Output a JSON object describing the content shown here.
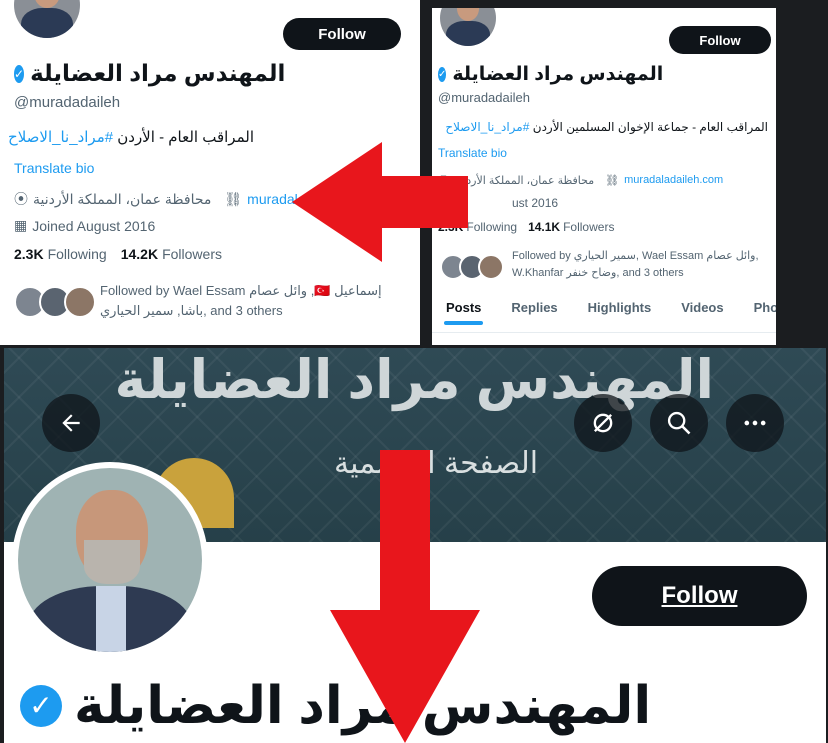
{
  "panel_left": {
    "follow_label": "Follow",
    "display_name": "المهندس مراد العضايلة",
    "handle": "@muradadaileh",
    "bio_text": "المراقب العام - الأردن ",
    "bio_hashtag": "#مراد_نا_الاصلاح",
    "translate": "Translate bio",
    "location": "محافظة عمان، المملكة الأردنية",
    "website": "muradaladail",
    "joined": "Joined August 2016",
    "following_count": "2.3K",
    "following_label": "Following",
    "followers_count": "14.2K",
    "followers_label": "Followers",
    "followed_by_line1": "Followed by Wael Essam وائل عصام ,🇹🇷 إسماعيل",
    "followed_by_line2": "باشا, سمير الحياري, and 3 others"
  },
  "panel_right": {
    "follow_label": "Follow",
    "display_name": "المهندس مراد العضايلة",
    "handle": "@muradadaileh",
    "bio_text": "المراقب العام - جماعة الإخوان المسلمين الأردن ",
    "bio_hashtag": "#مراد_نا_الاصلاح",
    "translate": "Translate bio",
    "location": "محافظة عمان، المملكة الأردنية",
    "website": "muradaladaileh.com",
    "joined": "ust 2016",
    "following_count": "2.3K",
    "following_label": "Following",
    "followers_count": "14.1K",
    "followers_label": "Followers",
    "followed_by_line1": "Followed by سمير الحياري, Wael Essam وائل عصام,",
    "followed_by_line2": "W.Khanfar وضاح خنفر, and 3 others",
    "tabs": [
      "Posts",
      "Replies",
      "Highlights",
      "Videos",
      "Photos"
    ]
  },
  "bottom": {
    "banner_title": "المهندس مراد العضايلة",
    "banner_subtitle": "الصفحة الرسمية",
    "follow_label": "Follow",
    "display_name": "المهندس مراد العضايلة"
  },
  "colors": {
    "accent": "#1d9bf0",
    "arrow": "#e8161c",
    "button": "#0f1419"
  },
  "icons": [
    "back-arrow-icon",
    "no-notifications-icon",
    "search-icon",
    "more-icon",
    "verified-icon",
    "location-icon",
    "link-icon",
    "calendar-icon"
  ]
}
